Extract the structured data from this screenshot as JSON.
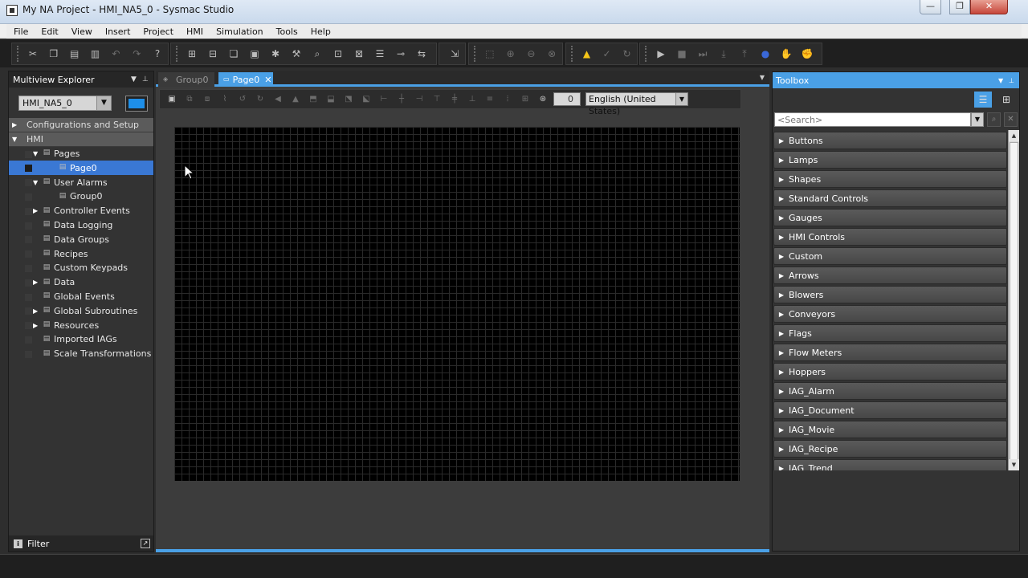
{
  "window": {
    "title": "My NA Project - HMI_NA5_0 - Sysmac Studio",
    "minimize_label": "—",
    "maximize_label": "❐",
    "close_label": "✕"
  },
  "menu": [
    "File",
    "Edit",
    "View",
    "Insert",
    "Project",
    "HMI",
    "Simulation",
    "Tools",
    "Help"
  ],
  "left_panel": {
    "title": "Multiview Explorer",
    "device": "HMI_NA5_0",
    "sections": {
      "config": "Configurations and Setup",
      "hmi": "HMI"
    },
    "tree": [
      {
        "label": "Pages",
        "exp": "▼",
        "indent": 1
      },
      {
        "label": "Page0",
        "exp": "",
        "indent": 2
      },
      {
        "label": "User Alarms",
        "exp": "▼",
        "indent": 1
      },
      {
        "label": "Group0",
        "exp": "",
        "indent": 2
      },
      {
        "label": "Controller Events",
        "exp": "▶",
        "indent": 1
      },
      {
        "label": "Data Logging",
        "exp": "",
        "indent": 1
      },
      {
        "label": "Data Groups",
        "exp": "",
        "indent": 1
      },
      {
        "label": "Recipes",
        "exp": "",
        "indent": 1
      },
      {
        "label": "Custom Keypads",
        "exp": "",
        "indent": 1
      },
      {
        "label": "Data",
        "exp": "▶",
        "indent": 1
      },
      {
        "label": "Global Events",
        "exp": "",
        "indent": 1
      },
      {
        "label": "Global Subroutines",
        "exp": "▶",
        "indent": 1
      },
      {
        "label": "Resources",
        "exp": "▶",
        "indent": 1
      },
      {
        "label": "Imported IAGs",
        "exp": "",
        "indent": 1
      },
      {
        "label": "Scale Transformations",
        "exp": "",
        "indent": 1
      }
    ],
    "filter_label": "Filter"
  },
  "editor": {
    "tabs": [
      {
        "label": "Group0"
      },
      {
        "label": "Page0"
      }
    ],
    "zoom_value": "0",
    "language": "English (United States)"
  },
  "toolbox": {
    "title": "Toolbox",
    "search_placeholder": "<Search>",
    "categories": [
      "Buttons",
      "Lamps",
      "Shapes",
      "Standard Controls",
      "Gauges",
      "HMI Controls",
      "Custom",
      "Arrows",
      "Blowers",
      "Conveyors",
      "Flags",
      "Flow Meters",
      "Hoppers",
      "IAG_Alarm",
      "IAG_Document",
      "IAG_Movie",
      "IAG_Recipe",
      "IAG_Trend"
    ]
  },
  "colors": {
    "accent": "#4aa0e6",
    "selection": "#3a78d4",
    "warning": "#f5c518"
  }
}
